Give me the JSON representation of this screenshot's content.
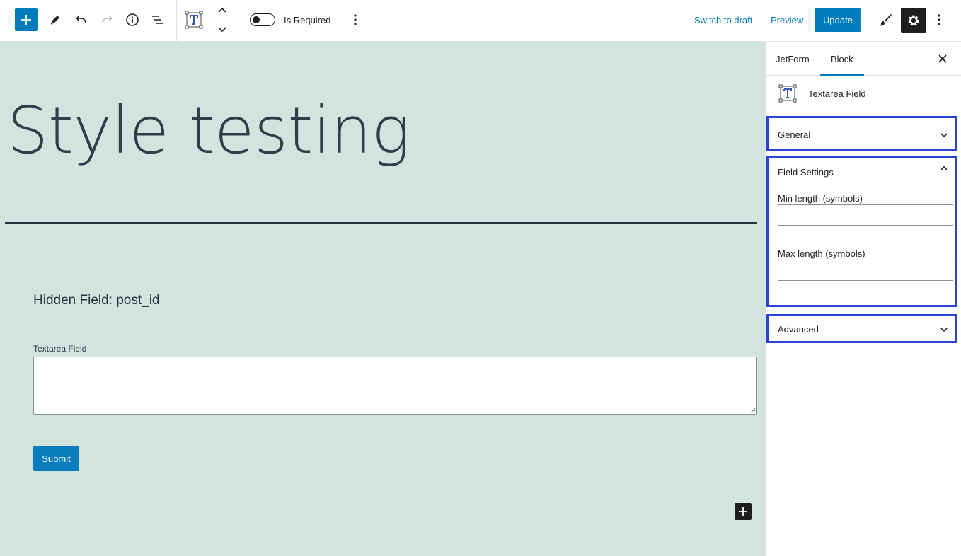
{
  "toolbar": {
    "is_required_label": "Is Required",
    "switch_to_draft": "Switch to draft",
    "preview": "Preview",
    "update": "Update"
  },
  "canvas": {
    "post_title": "Style testing",
    "hidden_field": "Hidden Field: post_id",
    "textarea_label": "Textarea Field",
    "submit_label": "Submit"
  },
  "sidebar": {
    "tabs": [
      {
        "label": "JetForm",
        "active": false
      },
      {
        "label": "Block",
        "active": true
      }
    ],
    "block_title": "Textarea Field",
    "panels": {
      "general": "General",
      "field_settings": "Field Settings",
      "advanced": "Advanced"
    },
    "field_settings": {
      "min_label": "Min length (symbols)",
      "min_value": "",
      "max_label": "Max length (symbols)",
      "max_value": ""
    }
  },
  "colors": {
    "accent": "#007cba",
    "canvas_bg": "#d2e4de",
    "panel_highlight": "#2845d8"
  }
}
